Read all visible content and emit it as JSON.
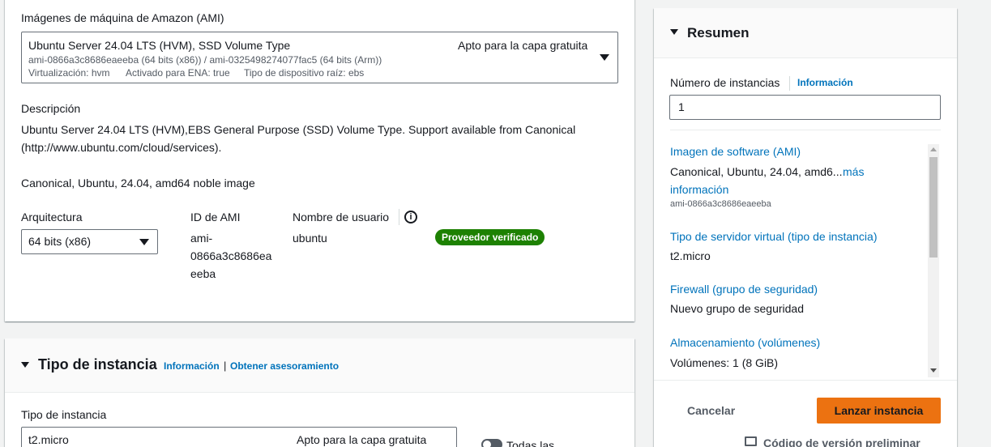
{
  "ami": {
    "heading": "Imágenes de máquina de Amazon (AMI)",
    "selected_name": "Ubuntu Server 24.04 LTS (HVM), SSD Volume Type",
    "free_tier": "Apto para la capa gratuita",
    "ids_line": "ami-0866a3c8686eaeeba (64 bits (x86)) / ami-0325498274077fac5 (64 bits (Arm))",
    "virt": "Virtualización: hvm",
    "ena": "Activado para ENA: true",
    "root_device": "Tipo de dispositivo raíz: ebs"
  },
  "description": {
    "heading": "Descripción",
    "line1": "Ubuntu Server 24.04 LTS (HVM),EBS General Purpose (SSD) Volume Type. Support available from Canonical",
    "line2": "(http://www.ubuntu.com/cloud/services).",
    "line3": "Canonical, Ubuntu, 24.04, amd64 noble image"
  },
  "architecture": {
    "label": "Arquitectura",
    "value": "64 bits (x86)"
  },
  "ami_id": {
    "label": "ID de AMI",
    "line1": "ami-",
    "line2": "0866a3c8686ea",
    "line3": "eeba"
  },
  "username": {
    "label": "Nombre de usuario",
    "value": "ubuntu"
  },
  "verified_badge": "Proveedor verificado",
  "instance_type_section": {
    "title": "Tipo de instancia",
    "info_link": "Información",
    "separator": "|",
    "advice_link": "Obtener asesoramiento",
    "field_label": "Tipo de instancia",
    "value": "t2.micro",
    "free_tier": "Apto para la capa gratuita",
    "toggle_label": "Todas las"
  },
  "summary": {
    "title": "Resumen",
    "instances_label": "Número de instancias",
    "instances_info": "Información",
    "instances_value": "1",
    "software_image_title": "Imagen de software (AMI)",
    "software_image_value": "Canonical, Ubuntu, 24.04, amd6...",
    "more_info_1": "más",
    "more_info_2": "información",
    "software_image_id": "ami-0866a3c8686eaeeba",
    "server_type_title": "Tipo de servidor virtual (tipo de instancia)",
    "server_type_value": "t2.micro",
    "firewall_title": "Firewall (grupo de seguridad)",
    "firewall_value": "Nuevo grupo de seguridad",
    "storage_title": "Almacenamiento (volúmenes)",
    "storage_value": "Volúmenes: 1 (8 GiB)",
    "cancel": "Cancelar",
    "launch": "Lanzar instancia",
    "preview_code": "Código de versión preliminar"
  },
  "colors": {
    "link": "#0073bb",
    "primary_button": "#ec7211",
    "verified": "#1d8102"
  }
}
